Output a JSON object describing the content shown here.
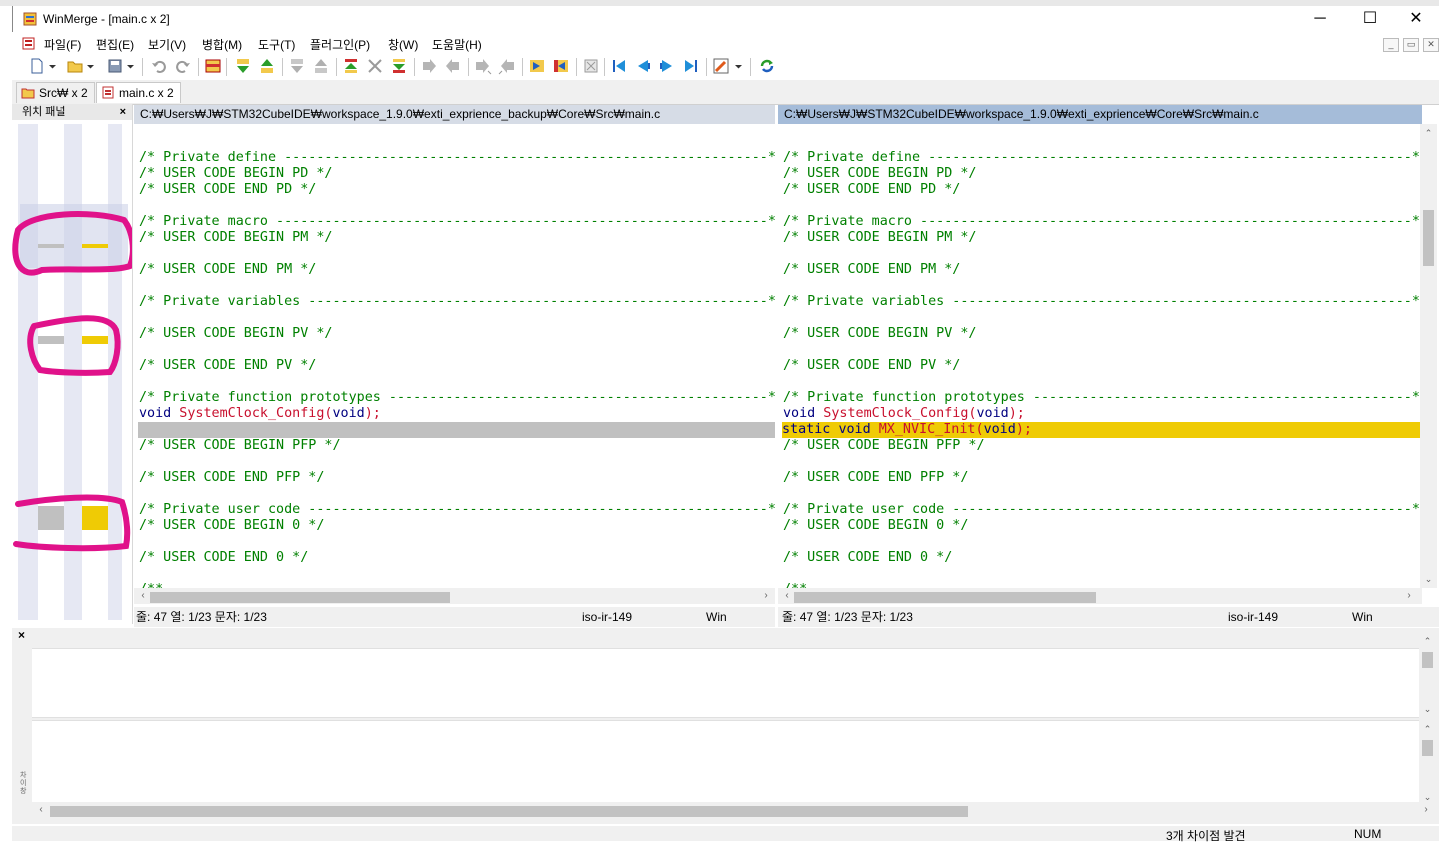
{
  "window": {
    "title": "WinMerge - [main.c x 2]",
    "minimize": "─",
    "maximize": "☐",
    "close": "✕"
  },
  "menu": [
    "파일(F)",
    "편집(E)",
    "보기(V)",
    "병합(M)",
    "도구(T)",
    "플러그인(P)",
    "창(W)",
    "도움말(H)"
  ],
  "mdi_buttons": [
    "_",
    "▭",
    "✕"
  ],
  "tabs": [
    {
      "label": "Src₩ x 2",
      "active": false
    },
    {
      "label": "main.c x 2",
      "active": true
    }
  ],
  "location_pane": {
    "title": "위치 패널",
    "close": "×",
    "colors": {
      "diff_left": "#c0c0c0",
      "diff_right": "#efcb05"
    }
  },
  "left": {
    "path": "C:₩Users₩J₩STM32CubeIDE₩workspace_1.9.0₩exti_exprience_backup₩Core₩Src₩main.c",
    "status": {
      "pos": "줄: 47  열: 1/23  문자: 1/23",
      "encoding": "iso-ir-149",
      "eol": "Win"
    }
  },
  "right": {
    "path": "C:₩Users₩J₩STM32CubeIDE₩workspace_1.9.0₩exti_exprience₩Core₩Src₩main.c",
    "status": {
      "pos": "줄: 47  열: 1/23  문자: 1/23",
      "encoding": "iso-ir-149",
      "eol": "Win"
    }
  },
  "code_left": [
    "",
    "/* Private define ------------------------------------------------------------*/",
    "/* USER CODE BEGIN PD */",
    "/* USER CODE END PD */",
    "",
    "/* Private macro -------------------------------------------------------------*/",
    "/* USER CODE BEGIN PM */",
    "",
    "/* USER CODE END PM */",
    "",
    "/* Private variables ---------------------------------------------------------*/",
    "",
    "/* USER CODE BEGIN PV */",
    "",
    "/* USER CODE END PV */",
    "",
    "/* Private function prototypes -----------------------------------------------*/",
    "void SystemClock_Config(void);",
    "",
    "/* USER CODE BEGIN PFP */",
    "",
    "/* USER CODE END PFP */",
    "",
    "/* Private user code ---------------------------------------------------------*/",
    "/* USER CODE BEGIN 0 */",
    "",
    "/* USER CODE END 0 */",
    "",
    "/**"
  ],
  "code_right": [
    "",
    "/* Private define ------------------------------------------------------------*/",
    "/* USER CODE BEGIN PD */",
    "/* USER CODE END PD */",
    "",
    "/* Private macro -------------------------------------------------------------*/",
    "/* USER CODE BEGIN PM */",
    "",
    "/* USER CODE END PM */",
    "",
    "/* Private variables ---------------------------------------------------------*/",
    "",
    "/* USER CODE BEGIN PV */",
    "",
    "/* USER CODE END PV */",
    "",
    "/* Private function prototypes -----------------------------------------------*/",
    "void SystemClock_Config(void);",
    "static void MX_NVIC_Init(void);",
    "/* USER CODE BEGIN PFP */",
    "",
    "/* USER CODE END PFP */",
    "",
    "/* Private user code ---------------------------------------------------------*/",
    "/* USER CODE BEGIN 0 */",
    "",
    "/* USER CODE END 0 */",
    "",
    "/**"
  ],
  "diff_line_index": 18,
  "colors": {
    "comment": "#008000",
    "keyword": "#000080",
    "diff_missing": "#c0c0c0",
    "diff_changed": "#efcb05",
    "annotation": "#e0128a"
  },
  "bottom_pane": {
    "side_label": "차이 창"
  },
  "status": {
    "diffs": "3개 차이점 발견",
    "num": "NUM"
  }
}
